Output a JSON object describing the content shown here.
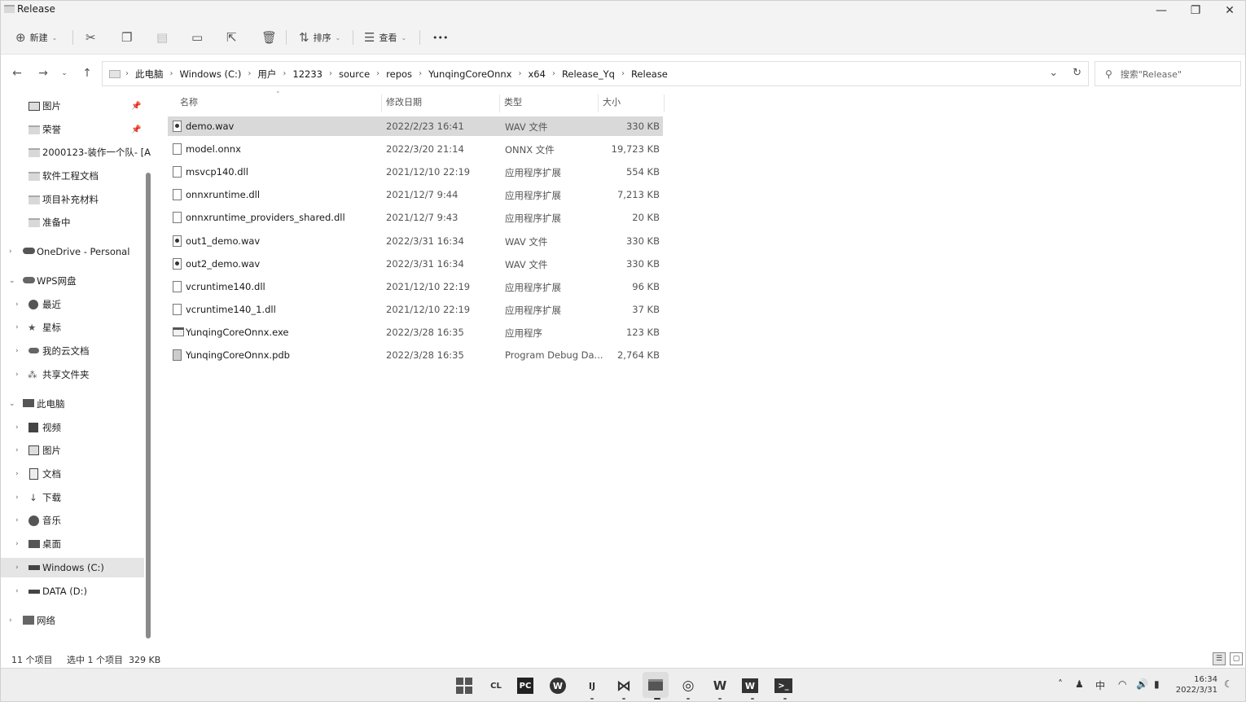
{
  "window": {
    "title": "Release",
    "controls": [
      "—",
      "❐",
      "✕"
    ]
  },
  "toolbar": {
    "new_label": "新建",
    "sort_label": "排序",
    "view_label": "查看",
    "more_label": "•••"
  },
  "address": {
    "crumbs": [
      "此电脑",
      "Windows (C:)",
      "用户",
      "12233",
      "source",
      "repos",
      "YunqingCoreOnnx",
      "x64",
      "Release_Yq",
      "Release"
    ]
  },
  "search": {
    "placeholder": "搜索\"Release\""
  },
  "sidebar": {
    "items": [
      {
        "label": "图片",
        "pinned": true
      },
      {
        "label": "荣誉",
        "pinned": true
      },
      {
        "label": "2000123-装作一个队- [A"
      },
      {
        "label": "软件工程文档"
      },
      {
        "label": "项目补充材料"
      },
      {
        "label": "准备中"
      },
      {
        "label": "OneDrive - Personal"
      },
      {
        "label": "WPS网盘"
      },
      {
        "label": "最近"
      },
      {
        "label": "星标"
      },
      {
        "label": "我的云文档"
      },
      {
        "label": "共享文件夹"
      },
      {
        "label": "此电脑"
      },
      {
        "label": "视频"
      },
      {
        "label": "图片"
      },
      {
        "label": "文档"
      },
      {
        "label": "下载"
      },
      {
        "label": "音乐"
      },
      {
        "label": "桌面"
      },
      {
        "label": "Windows (C:)"
      },
      {
        "label": "DATA (D:)"
      },
      {
        "label": "网络"
      }
    ]
  },
  "columns": {
    "name": "名称",
    "date": "修改日期",
    "type": "类型",
    "size": "大小"
  },
  "files": [
    {
      "name": "demo.wav",
      "date": "2022/2/23 16:41",
      "type": "WAV 文件",
      "size": "330 KB"
    },
    {
      "name": "model.onnx",
      "date": "2022/3/20 21:14",
      "type": "ONNX 文件",
      "size": "19,723 KB"
    },
    {
      "name": "msvcp140.dll",
      "date": "2021/12/10 22:19",
      "type": "应用程序扩展",
      "size": "554 KB"
    },
    {
      "name": "onnxruntime.dll",
      "date": "2021/12/7 9:44",
      "type": "应用程序扩展",
      "size": "7,213 KB"
    },
    {
      "name": "onnxruntime_providers_shared.dll",
      "date": "2021/12/7 9:43",
      "type": "应用程序扩展",
      "size": "20 KB"
    },
    {
      "name": "out1_demo.wav",
      "date": "2022/3/31 16:34",
      "type": "WAV 文件",
      "size": "330 KB"
    },
    {
      "name": "out2_demo.wav",
      "date": "2022/3/31 16:34",
      "type": "WAV 文件",
      "size": "330 KB"
    },
    {
      "name": "vcruntime140.dll",
      "date": "2021/12/10 22:19",
      "type": "应用程序扩展",
      "size": "96 KB"
    },
    {
      "name": "vcruntime140_1.dll",
      "date": "2021/12/10 22:19",
      "type": "应用程序扩展",
      "size": "37 KB"
    },
    {
      "name": "YunqingCoreOnnx.exe",
      "date": "2022/3/28 16:35",
      "type": "应用程序",
      "size": "123 KB"
    },
    {
      "name": "YunqingCoreOnnx.pdb",
      "date": "2022/3/28 16:35",
      "type": "Program Debug Da...",
      "size": "2,764 KB"
    }
  ],
  "status": {
    "count": "11 个项目",
    "selection": "选中 1 个项目  329 KB"
  },
  "taskbar": {
    "ime": "中",
    "time": "16:34",
    "date": "2022/3/31"
  },
  "colors": {
    "selection": "#d9d9d9",
    "chrome": "#f3f3f3"
  }
}
